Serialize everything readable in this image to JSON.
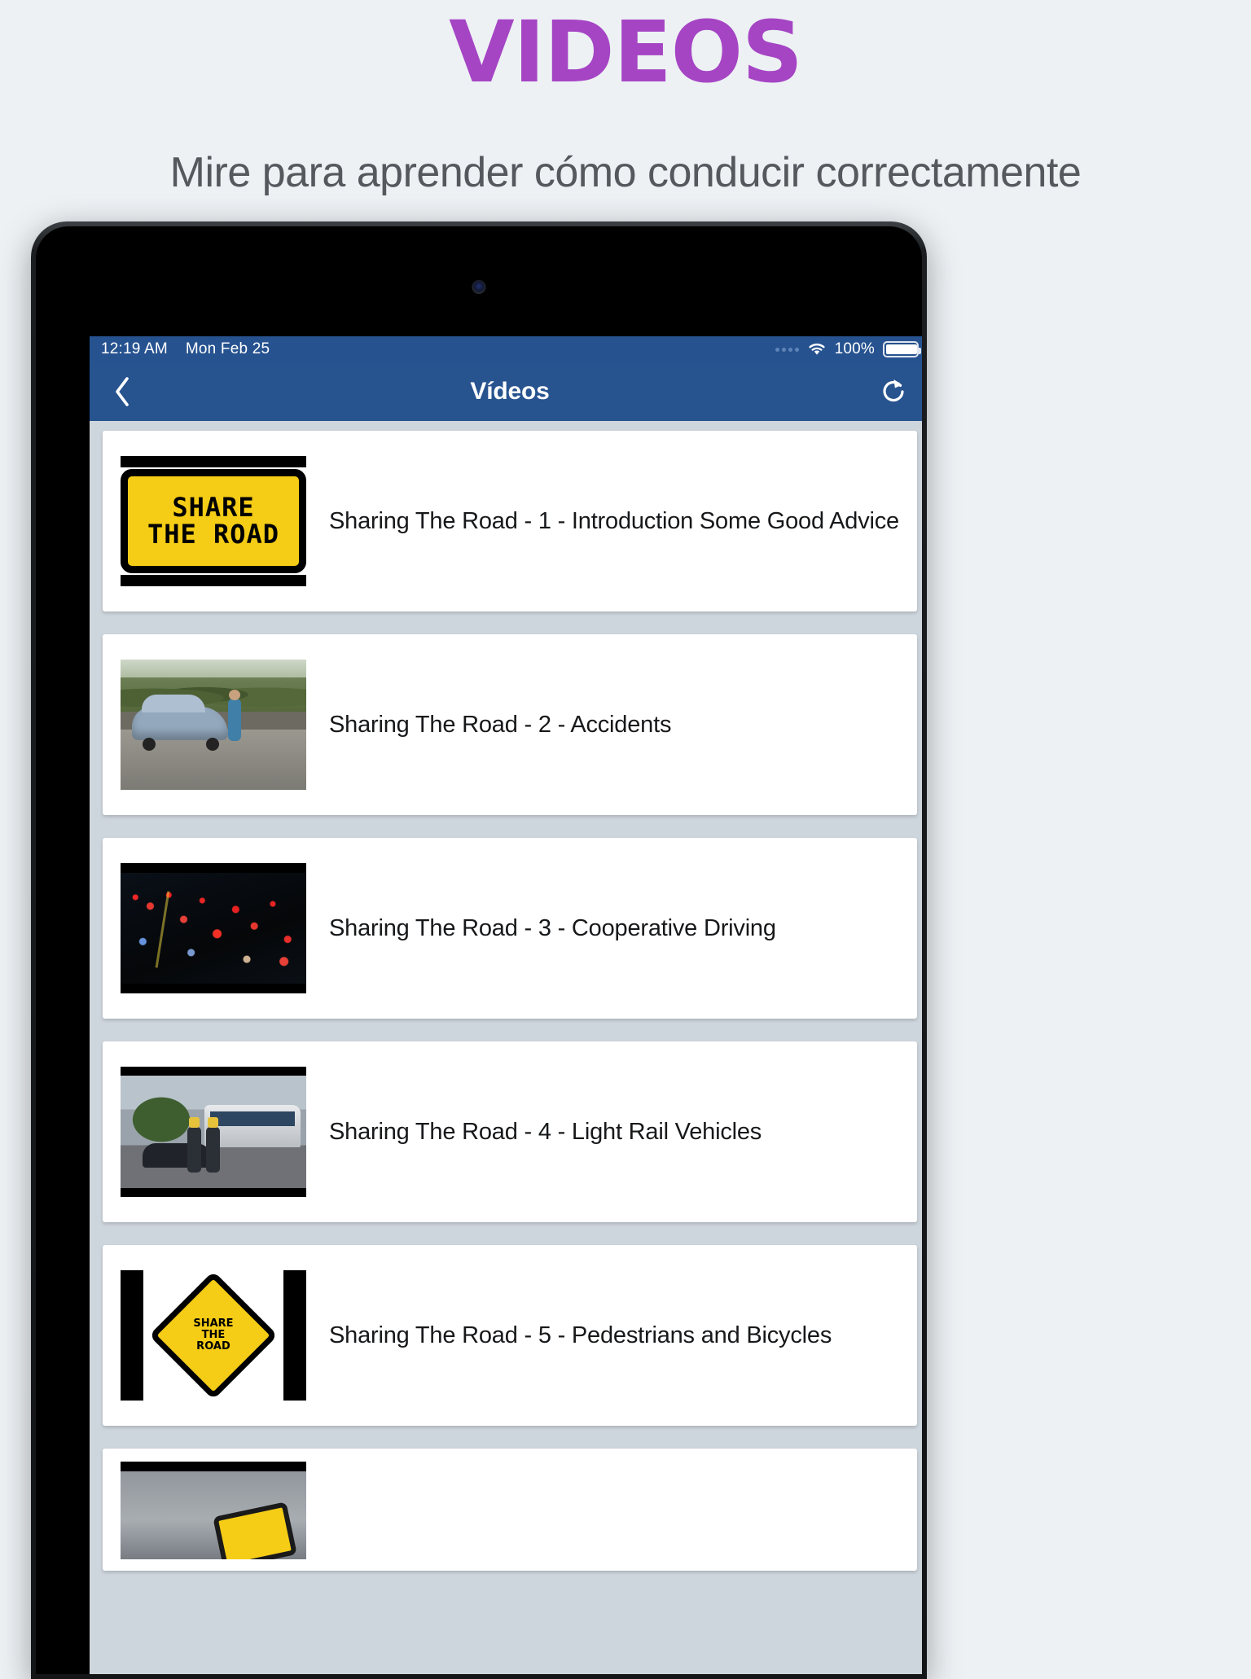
{
  "promo": {
    "title": "VIDEOS",
    "subtitle": "Mire para aprender cómo conducir correctamente",
    "title_color": "#a545c4",
    "subtitle_color": "#55595e",
    "background_color": "#edf1f4"
  },
  "statusbar": {
    "time": "12:19 AM",
    "date": "Mon Feb 25",
    "battery_percent": "100%",
    "wifi_icon": "wifi-icon",
    "battery_icon": "battery-full-icon",
    "signal_icon": "signal-dots-icon",
    "background_color": "#26528f"
  },
  "navbar": {
    "title": "Vídeos",
    "back_icon": "chevron-left-icon",
    "refresh_icon": "refresh-icon",
    "background_color": "#27538f",
    "text_color": "#ffffff"
  },
  "list": {
    "background_color": "#ced6dd",
    "items": [
      {
        "title": "Sharing The Road - 1 - Introduction Some Good Advice",
        "thumb": "share-the-road-rectangular-sign",
        "sign_line1": "SHARE",
        "sign_line2": "THE ROAD"
      },
      {
        "title": "Sharing The Road - 2 - Accidents",
        "thumb": "roadside-car-accident-photo"
      },
      {
        "title": "Sharing The Road - 3 - Cooperative Driving",
        "thumb": "night-traffic-jam-photo"
      },
      {
        "title": "Sharing The Road - 4 - Light Rail Vehicles",
        "thumb": "light-rail-street-scene-photo"
      },
      {
        "title": "Sharing The Road - 5 - Pedestrians and Bicycles",
        "thumb": "share-the-road-diamond-sign",
        "sign_line1": "SHARE",
        "sign_line2": "THE",
        "sign_line3": "ROAD"
      },
      {
        "title": "",
        "thumb": "overcast-sky-yellow-sign-photo"
      }
    ]
  }
}
